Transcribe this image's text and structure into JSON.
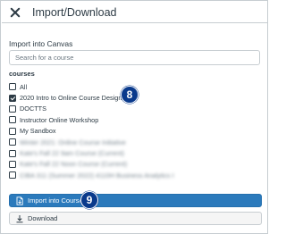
{
  "header": {
    "title": "Import/Download"
  },
  "import_section": {
    "label": "Import into Canvas",
    "search_placeholder": "Search for a course"
  },
  "courses": {
    "label": "courses",
    "items": [
      {
        "label": "All",
        "checked": false,
        "blurred": false
      },
      {
        "label": "2020 Intro to Online Course Design",
        "checked": true,
        "blurred": false
      },
      {
        "label": "DOCTTS",
        "checked": false,
        "blurred": false
      },
      {
        "label": "Instructor Online Workshop",
        "checked": false,
        "blurred": false
      },
      {
        "label": "My Sandbox",
        "checked": false,
        "blurred": false
      },
      {
        "label": "Winter 2021: Online Course Initiative",
        "checked": false,
        "blurred": true
      },
      {
        "label": "Kate's Fall 22 9am Course (Current)",
        "checked": false,
        "blurred": true
      },
      {
        "label": "Kate's Fall 22 Noon Course (Current)",
        "checked": false,
        "blurred": true
      },
      {
        "label": "CIBA 311 (Summer 2022) 4110H Business Analytics I",
        "checked": false,
        "blurred": true
      }
    ]
  },
  "callouts": {
    "step_8": "8",
    "step_9": "9"
  },
  "buttons": {
    "import_label": "Import into Course",
    "download_label": "Download"
  },
  "colors": {
    "primary": "#2b7abc",
    "callout": "#0a3a8c",
    "text": "#2d3b45",
    "border": "#c7cdd1"
  },
  "icons": {
    "close": "close-icon",
    "import": "document-import-icon",
    "download": "download-icon"
  }
}
